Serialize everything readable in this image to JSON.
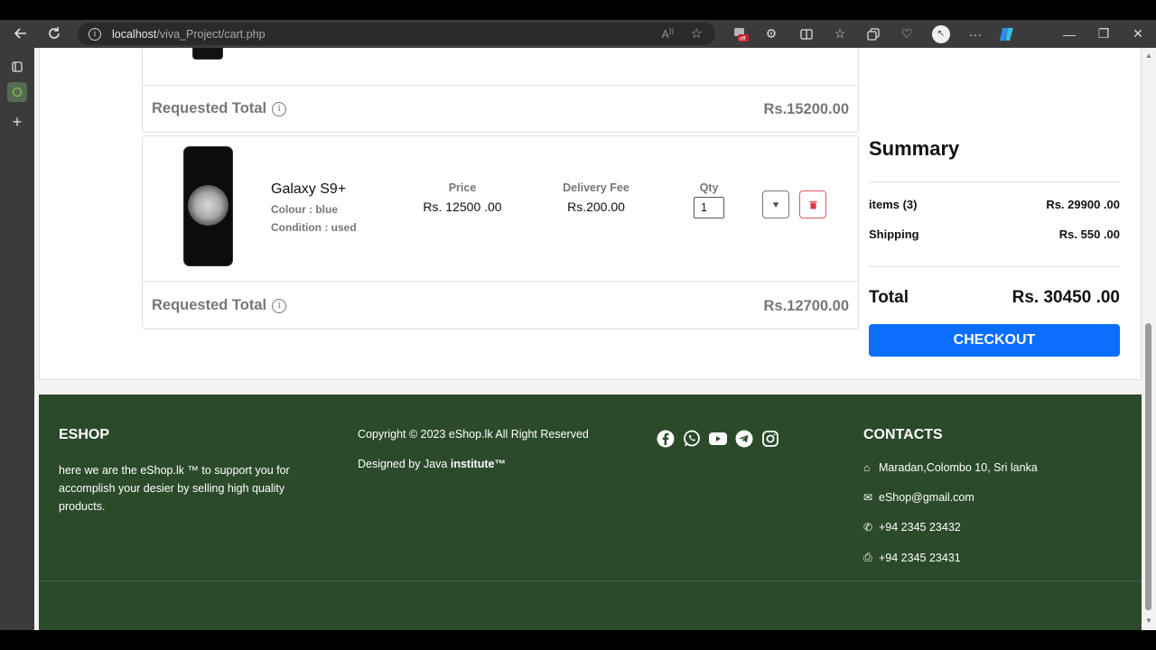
{
  "browser": {
    "url_host": "localhost",
    "url_path": "/viva_Project/cart.php",
    "read_aloud_icon": "read-aloud",
    "off_badge": "off"
  },
  "cart": {
    "item1": {
      "requested_total_label": "Requested Total",
      "requested_total_value": "Rs.15200.00"
    },
    "item2": {
      "name": "Galaxy S9+",
      "colour": "Colour : blue",
      "condition": "Condition : used",
      "price_label": "Price",
      "price_value": "Rs. 12500 .00",
      "delivery_label": "Delivery Fee",
      "delivery_value": "Rs.200.00",
      "qty_label": "Qty",
      "qty_value": "1",
      "requested_total_label": "Requested Total",
      "requested_total_value": "Rs.12700.00"
    }
  },
  "summary": {
    "title": "Summary",
    "items_label": "items (3)",
    "items_value": "Rs. 29900 .00",
    "shipping_label": "Shipping",
    "shipping_value": "Rs. 550 .00",
    "total_label": "Total",
    "total_value": "Rs. 30450 .00",
    "checkout_label": "CHECKOUT"
  },
  "footer": {
    "brand": "ESHOP",
    "about": "here we are the eShop.lk ™ to support you for accomplish your desier by selling high quality products.",
    "copyright": "Copyright © 2023 eShop.lk All Right Reserved",
    "designed_prefix": "Designed by Java ",
    "designed_bold": "institute™",
    "contacts_title": "CONTACTS",
    "address": "Maradan,Colombo 10, Sri lanka",
    "email": "eShop@gmail.com",
    "phone": "+94 2345 23432",
    "fax": "+94 2345 23431"
  },
  "colors": {
    "footer_bg": "#2a4a2a",
    "checkout_bg": "#0b6efd",
    "delete_red": "#d93545"
  }
}
